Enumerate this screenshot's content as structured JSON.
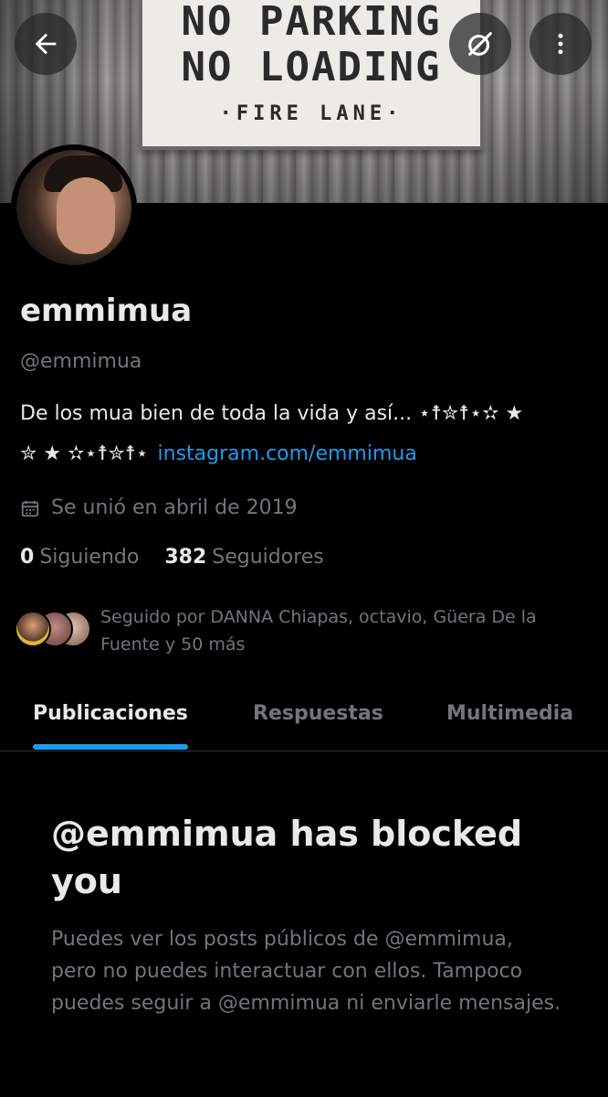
{
  "banner": {
    "sign_line1": "NO PARKING",
    "sign_line2": "NO LOADING",
    "sign_line3": "·FIRE LANE·"
  },
  "top_bar": {
    "back_icon": "arrow-left-icon",
    "grok_icon": "grok-icon",
    "more_icon": "more-vertical-icon"
  },
  "profile": {
    "display_name": "emmimua",
    "handle": "@emmimua",
    "bio_line1": "De los mua bien de toda la vida y así... ⋆☨✮☨⋆✫ ★",
    "bio_line2": "✮ ★ ✫⋆☨✮☨⋆",
    "bio_link": "instagram.com/emmimua",
    "joined": "Se unió en abril de 2019",
    "following_count": "0",
    "following_label": "Siguiendo",
    "followers_count": "382",
    "followers_label": "Seguidores",
    "followed_by": "Seguido por DANNA Chiapas, octavio, Güera De la Fuente y 50 más"
  },
  "tabs": [
    {
      "label": "Publicaciones",
      "active": true
    },
    {
      "label": "Respuestas",
      "active": false
    },
    {
      "label": "Multimedia",
      "active": false
    }
  ],
  "blocked": {
    "title": "@emmimua has blocked you",
    "body": "Puedes ver los posts públicos de @emmimua, pero no puedes interactuar con ellos. Tampoco puedes seguir a @emmimua ni enviarle mensajes."
  },
  "colors": {
    "background": "#000000",
    "primary_text": "#e7e9ea",
    "secondary_text": "#71767b",
    "accent": "#1d9bf0",
    "divider": "#2f3336"
  }
}
